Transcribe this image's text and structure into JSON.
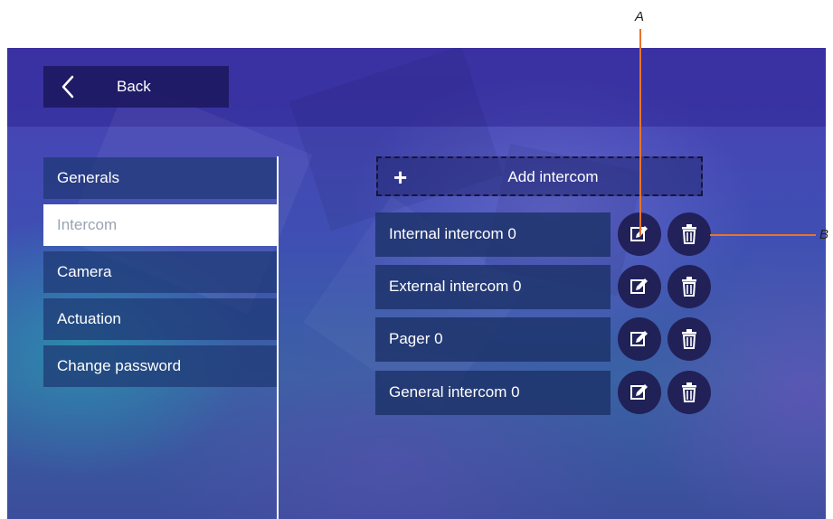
{
  "header": {
    "back_label": "Back"
  },
  "sidebar": {
    "items": [
      {
        "label": "Generals",
        "active": false
      },
      {
        "label": "Intercom",
        "active": true
      },
      {
        "label": "Camera",
        "active": false
      },
      {
        "label": "Actuation",
        "active": false
      },
      {
        "label": "Change password",
        "active": false
      }
    ]
  },
  "main": {
    "add_label": "Add intercom",
    "rows": [
      {
        "label": "Internal intercom 0"
      },
      {
        "label": "External intercom 0"
      },
      {
        "label": "Pager 0"
      },
      {
        "label": "General intercom 0"
      }
    ]
  },
  "callouts": {
    "a": "A",
    "b": "B"
  },
  "icons": {
    "back": "chevron-left-icon",
    "add": "plus-icon",
    "edit": "edit-icon",
    "delete": "trash-icon"
  },
  "colors": {
    "callout": "#e8732a",
    "active_item_bg": "#ffffff",
    "active_item_text": "#9aa3b5"
  }
}
